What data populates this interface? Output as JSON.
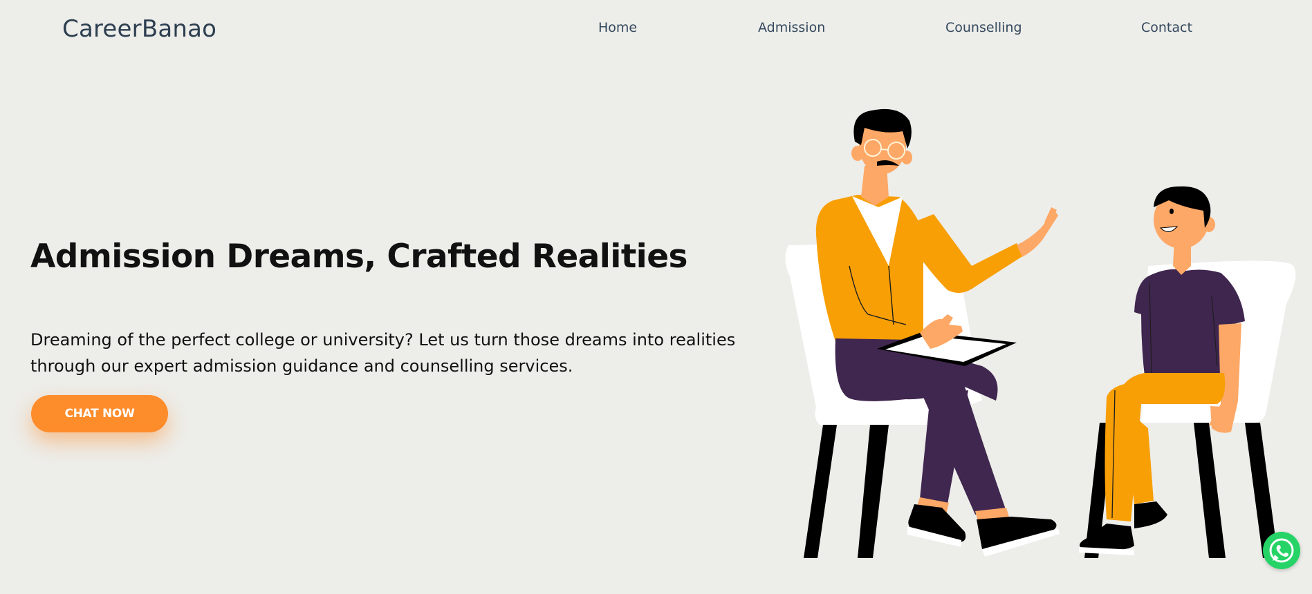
{
  "brand": {
    "name": "CareerBanao"
  },
  "nav": {
    "items": [
      {
        "label": "Home"
      },
      {
        "label": "Admission"
      },
      {
        "label": "Counselling"
      },
      {
        "label": "Contact"
      }
    ]
  },
  "hero": {
    "title": "Admission Dreams, Crafted Realities",
    "description": "Dreaming of the perfect college or university? Let us turn those dreams into realities through our expert admission guidance and counselling services.",
    "cta_label": "CHAT NOW"
  },
  "illustration": {
    "icon": "counselling-illustration"
  },
  "whatsapp": {
    "icon": "whatsapp-icon"
  },
  "colors": {
    "background": "#edede9",
    "accent": "#fd8c2b",
    "brand_text": "#2c3e50",
    "whatsapp": "#25d366"
  }
}
